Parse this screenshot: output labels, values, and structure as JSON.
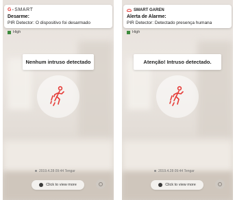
{
  "screens": [
    {
      "notification": {
        "brand_lead": "G",
        "brand_dash": "-",
        "brand_rest": "SMART",
        "app_name": "",
        "title": "Desarme:",
        "body": "PIR Detector: O dispositivo foi desarmado"
      },
      "signal_label": "High",
      "alert_text": "Nenhum intruso detectado",
      "timestamp": "2019.4.28 09:44 Tengar",
      "view_more_label": "Click to view more"
    },
    {
      "notification": {
        "brand_lead": "",
        "brand_dash": "",
        "brand_rest": "",
        "app_name": "SMART GAREN",
        "title": "Alerta de Alarme:",
        "body": "PIR Detector: Detectado presença humana"
      },
      "signal_label": "High",
      "alert_text": "Atenção! Intruso detectado.",
      "timestamp": "2019.4.28 09:44 Tengar",
      "view_more_label": "Click to view more"
    }
  ],
  "icons": {
    "motion": "motion-sensor-person-icon",
    "eye": "eye-icon",
    "settings": "gear-icon",
    "cloud": "cloud-icon"
  },
  "colors": {
    "accent": "#e53935",
    "signal": "#3d8b3d"
  }
}
